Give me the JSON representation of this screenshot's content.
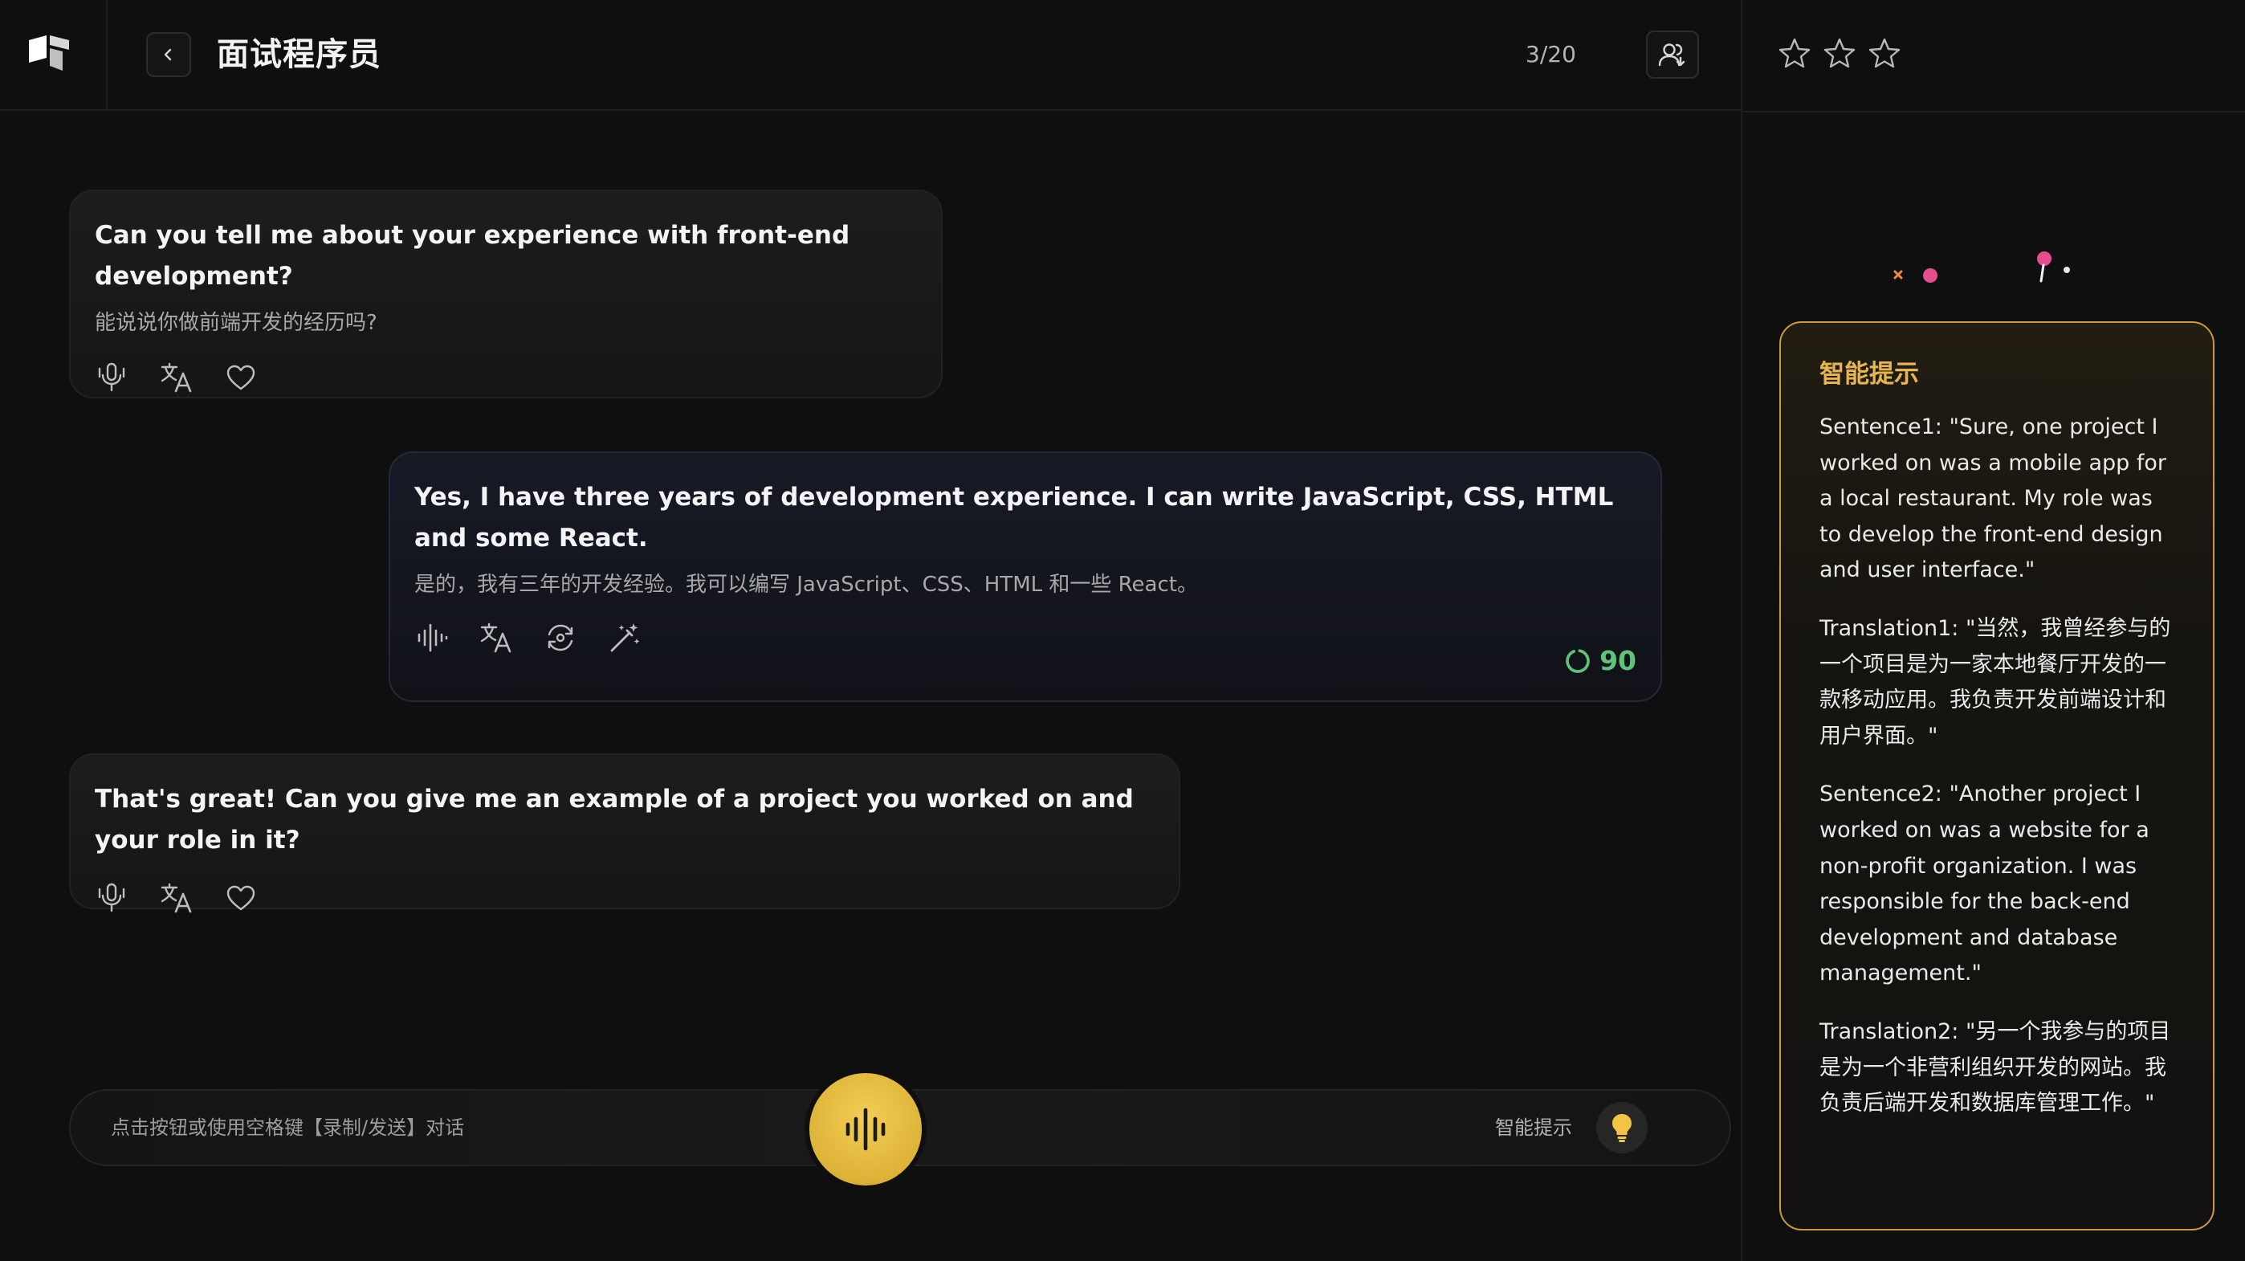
{
  "header": {
    "title": "面试程序员",
    "progress": "3/20",
    "star_count": 3
  },
  "messages": [
    {
      "role": "ai",
      "en": "Can you tell me about your experience with front-end development?",
      "zh": "能说说你做前端开发的经历吗?"
    },
    {
      "role": "user",
      "en": "Yes, I have three years of development experience. I can write JavaScript, CSS, HTML and some React.",
      "zh": "是的，我有三年的开发经验。我可以编写 JavaScript、CSS、HTML 和一些 React。",
      "score": "90"
    },
    {
      "role": "ai",
      "en": "That's great! Can you give me an example of a project you worked on and your role in it?"
    }
  ],
  "input": {
    "hint": "点击按钮或使用空格键【录制/发送】对话",
    "smart_hint_label": "智能提示"
  },
  "smart_hint": {
    "title": "智能提示",
    "paragraphs": [
      "Sentence1: \"Sure, one project I worked on was a mobile app for a local restaurant. My role was to develop the front-end design and user interface.\"",
      "Translation1: \"当然，我曾经参与的一个项目是为一家本地餐厅开发的一款移动应用。我负责开发前端设计和用户界面。\"",
      "Sentence2: \"Another project I worked on was a website for a non-profit organization. I was responsible for the back-end development and database management.\"",
      "Translation2: \"另一个我参与的项目是为一个非营利组织开发的网站。我负责后端开发和数据库管理工作。\""
    ]
  },
  "colors": {
    "accent_gold": "#e6b54e",
    "score_green": "#5ec47a",
    "mic_yellow": "#f3ce52",
    "decor_pink": "#e44d8f",
    "decor_orange": "#f08a3c"
  },
  "icons": {
    "logo": "app-logo-icon",
    "back": "chevron-left-icon",
    "contact": "user-group-icon",
    "star": "star-outline-icon",
    "listen": "speaker-wave-icon",
    "translate": "translate-icon",
    "favorite": "heart-icon",
    "waveform": "waveform-icon",
    "retry": "retry-icon",
    "polish": "magic-wand-icon",
    "score": "score-ring-icon",
    "mic": "microphone-waveform-icon",
    "bulb": "lightbulb-icon"
  }
}
